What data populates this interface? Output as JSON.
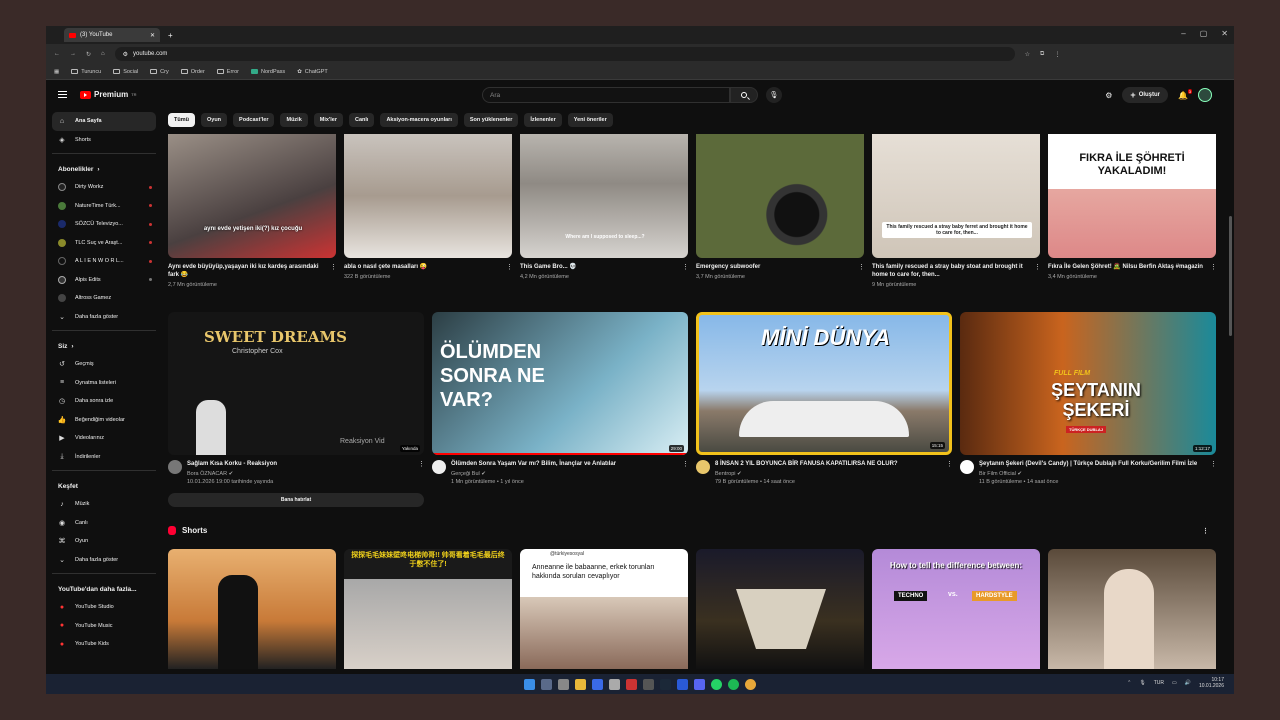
{
  "browser": {
    "tab_title": "(3) YouTube",
    "url": "youtube.com",
    "bookmarks": [
      "Turuncu",
      "Social",
      "Cry",
      "Order",
      "Error",
      "NordPass",
      "ChatGPT"
    ]
  },
  "header": {
    "logo": "Premium",
    "logo_region": "TR",
    "search_placeholder": "Ara",
    "create_label": "Oluştur",
    "notification_count": "3"
  },
  "sidebar": {
    "main": [
      {
        "label": "Ana Sayfa",
        "icon": "home-icon"
      },
      {
        "label": "Shorts",
        "icon": "shorts-icon"
      }
    ],
    "subs_heading": "Abonelikler",
    "subs": [
      {
        "label": "Dirty Workz",
        "color": "#222222"
      },
      {
        "label": "NatureTime Türk...",
        "color": "#4a7a3a"
      },
      {
        "label": "SÖZCÜ Televizyo...",
        "color": "#1a2a6a"
      },
      {
        "label": "TLC Suç ve Araşt...",
        "color": "#8a8a2a"
      },
      {
        "label": "A L I E N W O R L...",
        "color": "#111111"
      },
      {
        "label": "Alpis Edits",
        "color": "#333333"
      },
      {
        "label": "Altross Gamez",
        "color": "#444444"
      },
      {
        "label": "Daha fazla göster",
        "color": ""
      }
    ],
    "you_heading": "Siz",
    "you": [
      "Geçmiş",
      "Oynatma listeleri",
      "Daha sonra izle",
      "Beğendiğim videolar",
      "Videolarınız",
      "İndirilenler"
    ],
    "explore_heading": "Keşfet",
    "explore": [
      "Müzik",
      "Canlı",
      "Oyun",
      "Daha fazla göster"
    ],
    "more_heading": "YouTube'dan daha fazla...",
    "more": [
      "YouTube Studio",
      "YouTube Music",
      "YouTube Kids"
    ]
  },
  "chips": [
    "Tümü",
    "Oyun",
    "Podcast'ler",
    "Müzik",
    "Mix'ler",
    "Canlı",
    "Aksiyon-macera oyunları",
    "Son yüklenenler",
    "İzlenenler",
    "Yeni öneriler"
  ],
  "row1": [
    {
      "title": "Aynı evde büyüyüp,yaşayan iki kız kardeş arasındaki fark 😂",
      "sub": "2,7 Mn görüntüleme",
      "overlay": "aynı evde yetişen iki(?) kız çocuğu"
    },
    {
      "title": "abla o nasıl çete masalları 😜",
      "sub": "322 B görüntüleme",
      "overlay": ""
    },
    {
      "title": "This Game Bro... 💀",
      "sub": "4,2 Mn görüntüleme",
      "overlay": "Where am I supposed to sleep...?"
    },
    {
      "title": "Emergency subwoofer",
      "sub": "3,7 Mn görüntüleme",
      "overlay": ""
    },
    {
      "title": "This family rescued a stray baby stoat and brought it home to care for, then...",
      "sub": "9 Mn görüntüleme",
      "overlay": "This family rescued a stray baby ferret and brought it home to care for, then..."
    },
    {
      "title": "Fıkra İle Gelen Şöhret! 🧟 Nilsu Berfin Aktaş #magazin",
      "sub": "3,4 Mn görüntüleme",
      "overlay": "FIKRA İLE ŞÖHRETİ YAKALADIM!"
    }
  ],
  "row2": [
    {
      "title": "Sağlam Kısa Korku - Reaksiyon",
      "channel": "Bora ÖZNACAR ✔",
      "sub": "10.01.2026 19:00 tarihinde yayında",
      "thumb_title": "SWEET DREAMS",
      "thumb_sub": "Christopher Cox",
      "thumb_tag": "Reaksiyon Vid",
      "thumb_corner": "Yakında",
      "duration": ""
    },
    {
      "title": "Ölümden Sonra Yaşam Var mı? Bilim, İnançlar ve Anlatılar",
      "channel": "Gerçeği Bul ✔",
      "sub": "1 Mn görüntüleme • 1 yıl önce",
      "thumb_title": "ÖLÜMDEN SONRA NE VAR?",
      "duration": "29:00"
    },
    {
      "title": "8 İNSAN 2 YIL BOYUNCA BİR FANUSA KAPATILIRSA NE OLUR?",
      "channel": "Bentropi ✔",
      "sub": "79 B görüntüleme • 14 saat önce",
      "thumb_title": "MİNİ DÜNYA",
      "duration": "15:15"
    },
    {
      "title": "Şeytanın Şekeri (Devil's Candy) | Türkçe Dublajlı Full Korku/Gerilim Filmi İzle",
      "channel": "Bir Film Official ✔",
      "sub": "11 B görüntüleme • 14 saat önce",
      "thumb_title": "ŞEYTANIN ŞEKERİ",
      "thumb_tag": "FULL FILM",
      "thumb_corner": "TÜRKÇE DUBLAJ",
      "duration": "1:12:17"
    }
  ],
  "notify_label": "Bana hatırlat",
  "shorts_heading": "Shorts",
  "shorts": [
    {
      "overlay": ""
    },
    {
      "overlay": "探探毛毛妹妹壁咚电梯帅哥!! 帅哥看着毛毛最后终于憋不住了!"
    },
    {
      "overlay": "Anneanne ile babaanne, erkek torunları hakkında soruları cevaplıyor",
      "handle": "@türkiyesosyal"
    },
    {
      "overlay": ""
    },
    {
      "overlay": "How to tell the difference between:",
      "tag_a": "TECHNO",
      "vs": "vs.",
      "tag_b": "HARDSTYLE"
    },
    {
      "overlay": ""
    }
  ],
  "tray": {
    "lang": "TUR",
    "time": "10:17",
    "date": "10.01.2026"
  }
}
